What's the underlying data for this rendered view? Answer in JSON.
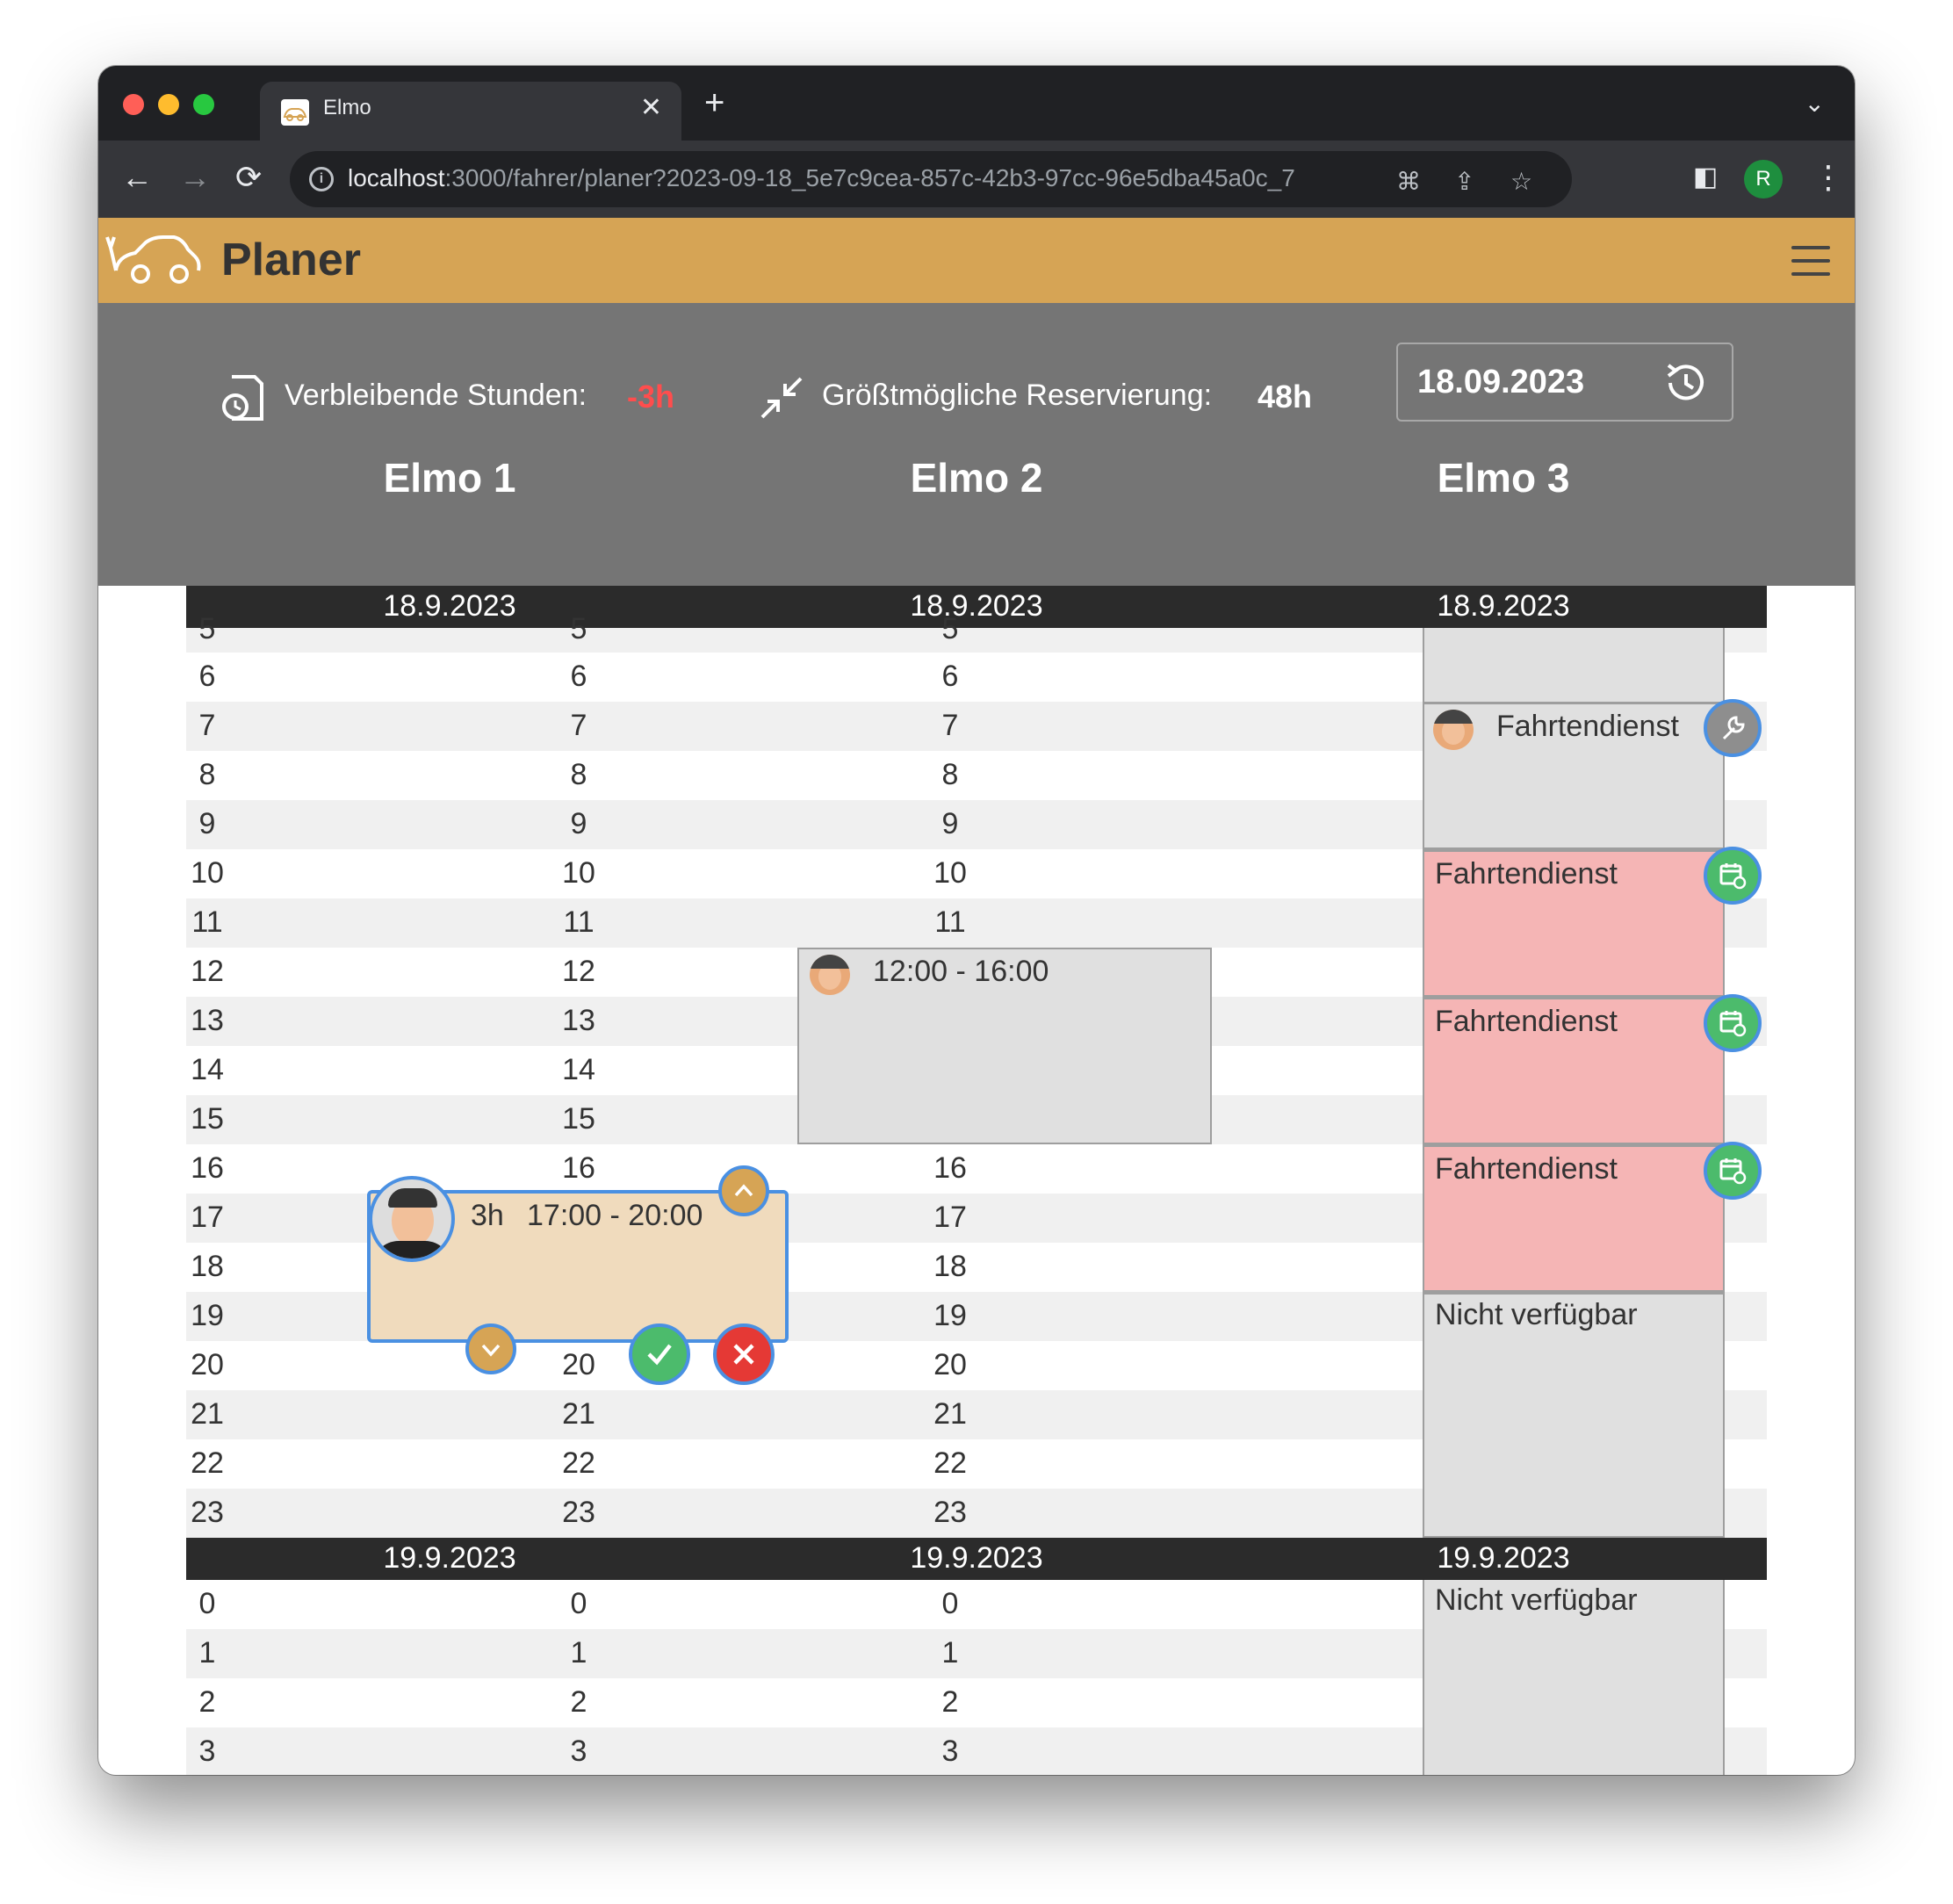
{
  "browser": {
    "tab_title": "Elmo",
    "url_host": "localhost",
    "url_rest": ":3000/fahrer/planer?2023-09-18_5e7c9cea-857c-42b3-97cc-96e5dba45a0c_7",
    "profile_initial": "R"
  },
  "header": {
    "title": "Planer"
  },
  "info": {
    "remaining_label": "Verbleibende Stunden:",
    "remaining_value": "-3h",
    "max_label": "Größtmögliche Reservierung:",
    "max_value": "48h",
    "date": "18.09.2023"
  },
  "columns": [
    "Elmo 1",
    "Elmo 2",
    "Elmo 3"
  ],
  "days": {
    "day1": "18.9.2023",
    "day2": "19.9.2023"
  },
  "day1_hours": [
    "5",
    "6",
    "7",
    "8",
    "9",
    "10",
    "11",
    "12",
    "13",
    "14",
    "15",
    "16",
    "17",
    "18",
    "19",
    "20",
    "21",
    "22",
    "23"
  ],
  "day2_hours": [
    "0",
    "1",
    "2",
    "3",
    "4",
    "5"
  ],
  "elmo1": {
    "draft": {
      "duration": "3h",
      "time": "17:00 - 20:00"
    }
  },
  "elmo2": {
    "booking": {
      "time": "12:00 - 16:00"
    }
  },
  "elmo3": {
    "maintenance": {
      "label": "Fahrtendienst"
    },
    "service1": {
      "label": "Fahrtendienst"
    },
    "service2": {
      "label": "Fahrtendienst"
    },
    "service3": {
      "label": "Fahrtendienst"
    },
    "unavailable1": {
      "label": "Nicht verfügbar"
    },
    "unavailable2": {
      "label": "Nicht verfügbar"
    }
  },
  "colors": {
    "header": "#d6a455",
    "infobar": "#757575",
    "negative": "#ff4d4d",
    "service_block": "#f5b5b5",
    "unavailable_block": "#e0e0e0",
    "draft_block": "#f0dbbd",
    "confirm": "#4cbb6c",
    "cancel": "#e53935"
  }
}
